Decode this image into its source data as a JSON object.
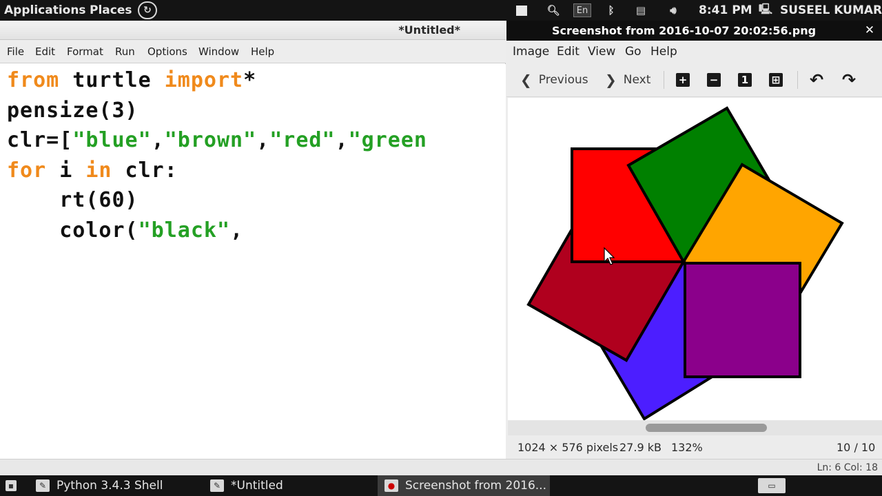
{
  "top_panel": {
    "applications": "Applications",
    "places": "Places",
    "keyboard_layout": "En",
    "time": "8:41 PM",
    "user": "SUSEEL KUMAR"
  },
  "editor": {
    "title": "*Untitled*",
    "menu": [
      "File",
      "Edit",
      "Format",
      "Run",
      "Options",
      "Window",
      "Help"
    ],
    "code": {
      "l1_from": "from",
      "l1_mid": " turtle ",
      "l1_import": "import",
      "l1_end": "*",
      "l2": "pensize(3)",
      "l3_a": "clr=[",
      "l3_b": "\"blue\"",
      "l3_c": ",",
      "l3_d": "\"brown\"",
      "l3_e": ",",
      "l3_f": "\"red\"",
      "l3_g": ",",
      "l3_h": "\"green",
      "l4_for": "for",
      "l4_i": " i ",
      "l4_in": "in",
      "l4_end": " clr:",
      "l5": "    rt(60)",
      "l6_a": "    color(",
      "l6_b": "\"black\"",
      "l6_c": ","
    },
    "status": "Ln: 6 Col: 18"
  },
  "viewer": {
    "title": "Screenshot from 2016-10-07 20:02:56.png",
    "menu": [
      "Image",
      "Edit",
      "View",
      "Go",
      "Help"
    ],
    "toolbar": {
      "previous": "Previous",
      "next": "Next",
      "zoom_in_icon": "+",
      "zoom_out_icon": "−",
      "normal_size_icon": "1",
      "best_fit_icon": "⊞",
      "rotate_left_icon": "↶",
      "rotate_right_icon": "↷"
    },
    "status": {
      "dimensions": "1024 × 576 pixels",
      "size": "27.9 kB",
      "zoom": "132%",
      "position": "10 / 10"
    },
    "image_colors": {
      "red": "#ff0000",
      "green": "#008000",
      "orange": "#ffa500",
      "purple": "#8b008b",
      "blue": "#4c1eff",
      "brown": "#b0001e"
    }
  },
  "taskbar": {
    "items": [
      "Python 3.4.3 Shell",
      "*Untitled",
      "Screenshot from 2016..."
    ]
  }
}
